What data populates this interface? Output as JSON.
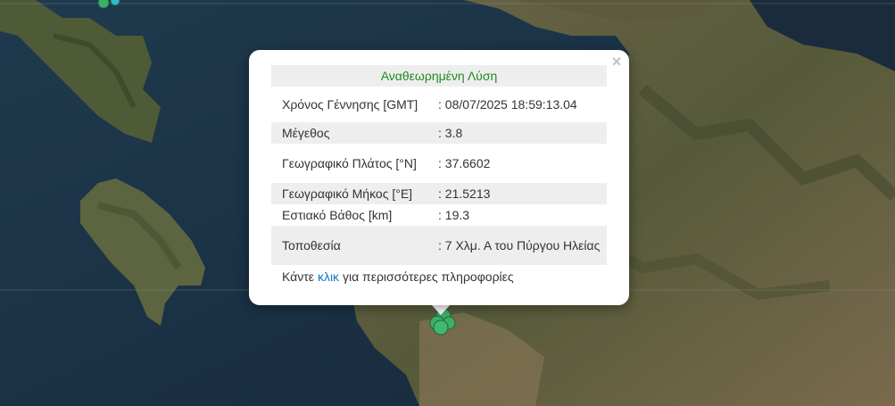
{
  "popup": {
    "title": "Αναθεωρημένη Λύση",
    "close_symbol": "×",
    "rows": [
      {
        "label": "Χρόνος Γέννησης [GMT]",
        "value": ": 08/07/2025 18:59:13.04"
      },
      {
        "label": "Μέγεθος",
        "value": ": 3.8"
      },
      {
        "label": "Γεωγραφικό Πλάτος [°N]",
        "value": ": 37.6602"
      },
      {
        "label": "Γεωγραφικό Μήκος [°E]",
        "value": ": 21.5213"
      },
      {
        "label": "Εστιακό Βάθος [km]",
        "value": ": 19.3"
      },
      {
        "label": "Τοποθεσία",
        "value": ": 7 Χλμ. Α του Πύργου Ηλείας"
      }
    ],
    "more_prefix": "Κάντε",
    "more_link": "κλικ",
    "more_suffix": "για περισσότερες πληροφορίες"
  },
  "map": {
    "colors": {
      "sea": "#1b3346",
      "land": "#5a5a3c",
      "land_dark": "#3d4a2c",
      "land_light": "#7a6e50",
      "marker_fill": "#3fae6a",
      "marker_stroke": "#1d6b3a",
      "marker_cyan": "#34b8c8"
    },
    "markers_icon": "earthquake-marker-icon"
  }
}
